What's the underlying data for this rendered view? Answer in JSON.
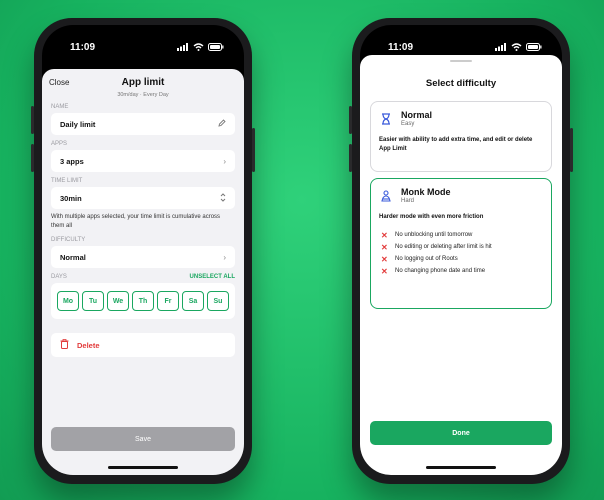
{
  "left_phone": {
    "status": {
      "time": "11:09"
    },
    "header": {
      "close_label": "Close",
      "title": "App limit",
      "subtitle": "30m/day · Every Day"
    },
    "name": {
      "label": "NAME",
      "value": "Daily limit"
    },
    "apps": {
      "label": "APPS",
      "value": "3 apps"
    },
    "time_limit": {
      "label": "TIME LIMIT",
      "value": "30min",
      "note": "With multiple apps selected, your time limit is cumulative across them all"
    },
    "difficulty": {
      "label": "DIFFICULTY",
      "value": "Normal"
    },
    "days": {
      "label": "DAYS",
      "action": "UNSELECT ALL",
      "items": [
        "Mo",
        "Tu",
        "We",
        "Th",
        "Fr",
        "Sa",
        "Su"
      ]
    },
    "delete_label": "Delete",
    "save_label": "Save"
  },
  "right_phone": {
    "status": {
      "time": "11:09"
    },
    "title": "Select difficulty",
    "normal": {
      "name": "Normal",
      "level": "Easy",
      "description": "Easier with ability to add extra time, and edit or delete App Limit",
      "icon": "hourglass-icon"
    },
    "monk": {
      "name": "Monk Mode",
      "level": "Hard",
      "description": "Harder mode with even more friction",
      "icon": "monk-icon",
      "rules": [
        "No unblocking until tomorrow",
        "No editing or deleting after limit is hit",
        "No logging out of Roots",
        "No changing phone date and time"
      ]
    },
    "done_label": "Done"
  },
  "colors": {
    "accent": "#1aa760",
    "danger": "#e23b3b",
    "background": "#1fbf6a"
  }
}
